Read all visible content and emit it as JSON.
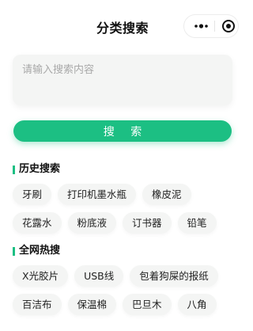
{
  "nav": {
    "title": "分类搜索"
  },
  "search": {
    "placeholder": "请输入搜索内容",
    "button_label": "搜 索"
  },
  "history": {
    "title": "历史搜索",
    "rows": [
      [
        "牙刷",
        "打印机墨水瓶",
        "橡皮泥"
      ],
      [
        "花露水",
        "粉底液",
        "订书器",
        "铅笔"
      ]
    ]
  },
  "hot": {
    "title": "全网热搜",
    "rows": [
      [
        "X光胶片",
        "USB线",
        "包着狗屎的报纸"
      ],
      [
        "百洁布",
        "保温棉",
        "巴旦木",
        "八角"
      ]
    ]
  },
  "colors": {
    "accent": "#1cbf83",
    "tag_bg": "#f4f5f4"
  }
}
